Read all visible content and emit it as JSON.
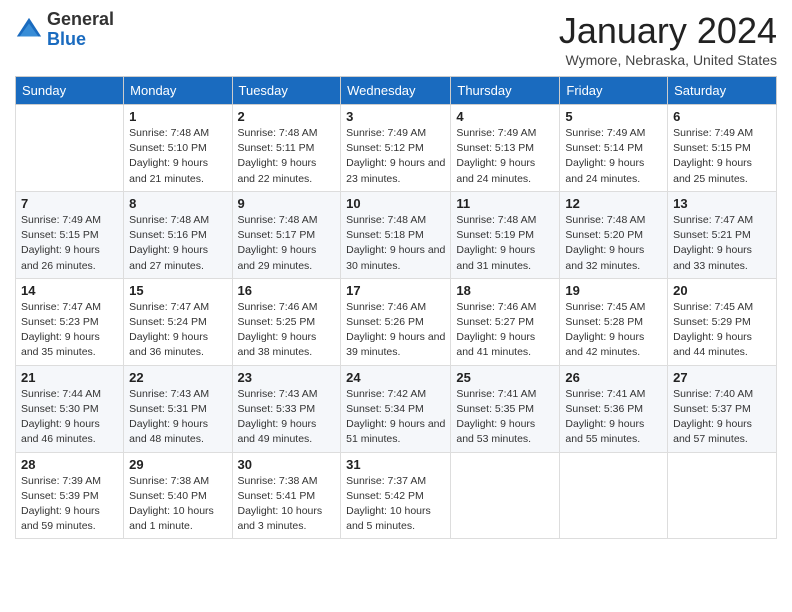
{
  "logo": {
    "general": "General",
    "blue": "Blue"
  },
  "header": {
    "month": "January 2024",
    "location": "Wymore, Nebraska, United States"
  },
  "weekdays": [
    "Sunday",
    "Monday",
    "Tuesday",
    "Wednesday",
    "Thursday",
    "Friday",
    "Saturday"
  ],
  "weeks": [
    [
      {
        "day": "",
        "sunrise": "",
        "sunset": "",
        "daylight": ""
      },
      {
        "day": "1",
        "sunrise": "Sunrise: 7:48 AM",
        "sunset": "Sunset: 5:10 PM",
        "daylight": "Daylight: 9 hours and 21 minutes."
      },
      {
        "day": "2",
        "sunrise": "Sunrise: 7:48 AM",
        "sunset": "Sunset: 5:11 PM",
        "daylight": "Daylight: 9 hours and 22 minutes."
      },
      {
        "day": "3",
        "sunrise": "Sunrise: 7:49 AM",
        "sunset": "Sunset: 5:12 PM",
        "daylight": "Daylight: 9 hours and 23 minutes."
      },
      {
        "day": "4",
        "sunrise": "Sunrise: 7:49 AM",
        "sunset": "Sunset: 5:13 PM",
        "daylight": "Daylight: 9 hours and 24 minutes."
      },
      {
        "day": "5",
        "sunrise": "Sunrise: 7:49 AM",
        "sunset": "Sunset: 5:14 PM",
        "daylight": "Daylight: 9 hours and 24 minutes."
      },
      {
        "day": "6",
        "sunrise": "Sunrise: 7:49 AM",
        "sunset": "Sunset: 5:15 PM",
        "daylight": "Daylight: 9 hours and 25 minutes."
      }
    ],
    [
      {
        "day": "7",
        "sunrise": "Sunrise: 7:49 AM",
        "sunset": "Sunset: 5:15 PM",
        "daylight": "Daylight: 9 hours and 26 minutes."
      },
      {
        "day": "8",
        "sunrise": "Sunrise: 7:48 AM",
        "sunset": "Sunset: 5:16 PM",
        "daylight": "Daylight: 9 hours and 27 minutes."
      },
      {
        "day": "9",
        "sunrise": "Sunrise: 7:48 AM",
        "sunset": "Sunset: 5:17 PM",
        "daylight": "Daylight: 9 hours and 29 minutes."
      },
      {
        "day": "10",
        "sunrise": "Sunrise: 7:48 AM",
        "sunset": "Sunset: 5:18 PM",
        "daylight": "Daylight: 9 hours and 30 minutes."
      },
      {
        "day": "11",
        "sunrise": "Sunrise: 7:48 AM",
        "sunset": "Sunset: 5:19 PM",
        "daylight": "Daylight: 9 hours and 31 minutes."
      },
      {
        "day": "12",
        "sunrise": "Sunrise: 7:48 AM",
        "sunset": "Sunset: 5:20 PM",
        "daylight": "Daylight: 9 hours and 32 minutes."
      },
      {
        "day": "13",
        "sunrise": "Sunrise: 7:47 AM",
        "sunset": "Sunset: 5:21 PM",
        "daylight": "Daylight: 9 hours and 33 minutes."
      }
    ],
    [
      {
        "day": "14",
        "sunrise": "Sunrise: 7:47 AM",
        "sunset": "Sunset: 5:23 PM",
        "daylight": "Daylight: 9 hours and 35 minutes."
      },
      {
        "day": "15",
        "sunrise": "Sunrise: 7:47 AM",
        "sunset": "Sunset: 5:24 PM",
        "daylight": "Daylight: 9 hours and 36 minutes."
      },
      {
        "day": "16",
        "sunrise": "Sunrise: 7:46 AM",
        "sunset": "Sunset: 5:25 PM",
        "daylight": "Daylight: 9 hours and 38 minutes."
      },
      {
        "day": "17",
        "sunrise": "Sunrise: 7:46 AM",
        "sunset": "Sunset: 5:26 PM",
        "daylight": "Daylight: 9 hours and 39 minutes."
      },
      {
        "day": "18",
        "sunrise": "Sunrise: 7:46 AM",
        "sunset": "Sunset: 5:27 PM",
        "daylight": "Daylight: 9 hours and 41 minutes."
      },
      {
        "day": "19",
        "sunrise": "Sunrise: 7:45 AM",
        "sunset": "Sunset: 5:28 PM",
        "daylight": "Daylight: 9 hours and 42 minutes."
      },
      {
        "day": "20",
        "sunrise": "Sunrise: 7:45 AM",
        "sunset": "Sunset: 5:29 PM",
        "daylight": "Daylight: 9 hours and 44 minutes."
      }
    ],
    [
      {
        "day": "21",
        "sunrise": "Sunrise: 7:44 AM",
        "sunset": "Sunset: 5:30 PM",
        "daylight": "Daylight: 9 hours and 46 minutes."
      },
      {
        "day": "22",
        "sunrise": "Sunrise: 7:43 AM",
        "sunset": "Sunset: 5:31 PM",
        "daylight": "Daylight: 9 hours and 48 minutes."
      },
      {
        "day": "23",
        "sunrise": "Sunrise: 7:43 AM",
        "sunset": "Sunset: 5:33 PM",
        "daylight": "Daylight: 9 hours and 49 minutes."
      },
      {
        "day": "24",
        "sunrise": "Sunrise: 7:42 AM",
        "sunset": "Sunset: 5:34 PM",
        "daylight": "Daylight: 9 hours and 51 minutes."
      },
      {
        "day": "25",
        "sunrise": "Sunrise: 7:41 AM",
        "sunset": "Sunset: 5:35 PM",
        "daylight": "Daylight: 9 hours and 53 minutes."
      },
      {
        "day": "26",
        "sunrise": "Sunrise: 7:41 AM",
        "sunset": "Sunset: 5:36 PM",
        "daylight": "Daylight: 9 hours and 55 minutes."
      },
      {
        "day": "27",
        "sunrise": "Sunrise: 7:40 AM",
        "sunset": "Sunset: 5:37 PM",
        "daylight": "Daylight: 9 hours and 57 minutes."
      }
    ],
    [
      {
        "day": "28",
        "sunrise": "Sunrise: 7:39 AM",
        "sunset": "Sunset: 5:39 PM",
        "daylight": "Daylight: 9 hours and 59 minutes."
      },
      {
        "day": "29",
        "sunrise": "Sunrise: 7:38 AM",
        "sunset": "Sunset: 5:40 PM",
        "daylight": "Daylight: 10 hours and 1 minute."
      },
      {
        "day": "30",
        "sunrise": "Sunrise: 7:38 AM",
        "sunset": "Sunset: 5:41 PM",
        "daylight": "Daylight: 10 hours and 3 minutes."
      },
      {
        "day": "31",
        "sunrise": "Sunrise: 7:37 AM",
        "sunset": "Sunset: 5:42 PM",
        "daylight": "Daylight: 10 hours and 5 minutes."
      },
      {
        "day": "",
        "sunrise": "",
        "sunset": "",
        "daylight": ""
      },
      {
        "day": "",
        "sunrise": "",
        "sunset": "",
        "daylight": ""
      },
      {
        "day": "",
        "sunrise": "",
        "sunset": "",
        "daylight": ""
      }
    ]
  ]
}
